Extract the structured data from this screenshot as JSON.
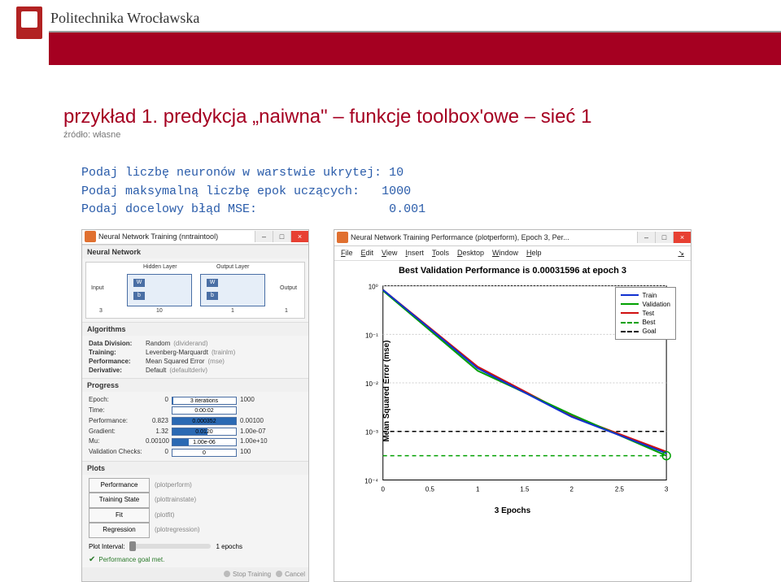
{
  "header": {
    "university": "Politechnika Wrocławska"
  },
  "slide": {
    "title": "przykład 1. predykcja „naiwna\" – funkcje toolbox'owe – sieć 1",
    "source": "źródło: własne"
  },
  "prompts": {
    "line1_label": "Podaj liczbę neuronów w warstwie ukrytej:",
    "line1_val": "10",
    "line2_label": "Podaj maksymalną liczbę epok uczących:",
    "line2_val": "1000",
    "line3_label": "Podaj docelowy błąd MSE:",
    "line3_val": "0.001"
  },
  "tool": {
    "window_title": "Neural Network Training (nntraintool)",
    "section_nn": "Neural Network",
    "diagram": {
      "input": "Input",
      "hidden": "Hidden Layer",
      "output_layer": "Output Layer",
      "output": "Output",
      "in_size": "3",
      "hidden_size": "10",
      "out_size": "1",
      "out_out": "1"
    },
    "section_algo": "Algorithms",
    "algos": [
      {
        "k": "Data Division:",
        "v": "Random",
        "g": "(dividerand)"
      },
      {
        "k": "Training:",
        "v": "Levenberg-Marquardt",
        "g": "(trainlm)"
      },
      {
        "k": "Performance:",
        "v": "Mean Squared Error",
        "g": "(mse)"
      },
      {
        "k": "Derivative:",
        "v": "Default",
        "g": "(defaultderiv)"
      }
    ],
    "section_prog": "Progress",
    "progress": [
      {
        "k": "Epoch:",
        "left": "0",
        "text": "3 iterations",
        "right": "1000",
        "fill": 0.003
      },
      {
        "k": "Time:",
        "left": "",
        "text": "0:00:02",
        "right": "",
        "fill": 0
      },
      {
        "k": "Performance:",
        "left": "0.823",
        "text": "0.000352",
        "right": "0.00100",
        "fill": 1.0
      },
      {
        "k": "Gradient:",
        "left": "1.32",
        "text": "0.0120",
        "right": "1.00e-07",
        "fill": 0.55
      },
      {
        "k": "Mu:",
        "left": "0.00100",
        "text": "1.00e-06",
        "right": "1.00e+10",
        "fill": 0.25
      },
      {
        "k": "Validation Checks:",
        "left": "0",
        "text": "0",
        "right": "100",
        "fill": 0
      }
    ],
    "section_plots": "Plots",
    "plots": [
      {
        "btn": "Performance",
        "lab": "(plotperform)"
      },
      {
        "btn": "Training State",
        "lab": "(plottrainstate)"
      },
      {
        "btn": "Fit",
        "lab": "(plotfit)"
      },
      {
        "btn": "Regression",
        "lab": "(plotregression)"
      }
    ],
    "plot_interval_label": "Plot Interval:",
    "plot_interval_value": "1 epochs",
    "goal_msg": "Performance goal met.",
    "stop_btn": "Stop Training",
    "cancel_btn": "Cancel"
  },
  "perf": {
    "window_title": "Neural Network Training Performance (plotperform), Epoch 3, Per...",
    "menu": [
      "File",
      "Edit",
      "View",
      "Insert",
      "Tools",
      "Desktop",
      "Window",
      "Help"
    ],
    "title": "Best Validation Performance is 0.00031596 at epoch 3",
    "ylabel": "Mean Squared Error (mse)",
    "xlabel": "3 Epochs",
    "legend": [
      {
        "label": "Train",
        "color": "#1030d0",
        "dash": false
      },
      {
        "label": "Validation",
        "color": "#00a000",
        "dash": false
      },
      {
        "label": "Test",
        "color": "#d01010",
        "dash": false
      },
      {
        "label": "Best",
        "color": "#00a000",
        "dash": true
      },
      {
        "label": "Goal",
        "color": "#101010",
        "dash": true
      }
    ],
    "xticks": [
      "0",
      "0.5",
      "1",
      "1.5",
      "2",
      "2.5",
      "3"
    ],
    "yticks": [
      "10⁰",
      "10⁻¹",
      "10⁻²",
      "10⁻³",
      "10⁻⁴"
    ]
  },
  "chart_data": {
    "type": "line",
    "title": "Best Validation Performance is 0.00031596 at epoch 3",
    "xlabel": "3 Epochs",
    "ylabel": "Mean Squared Error (mse)",
    "x": [
      0,
      1,
      2,
      3
    ],
    "yscale": "log",
    "ylim": [
      0.0001,
      1
    ],
    "xlim": [
      0,
      3
    ],
    "series": [
      {
        "name": "Train",
        "color": "#1030d0",
        "values": [
          0.823,
          0.02,
          0.002,
          0.00035
        ]
      },
      {
        "name": "Validation",
        "color": "#00a000",
        "values": [
          0.8,
          0.018,
          0.0022,
          0.00032
        ]
      },
      {
        "name": "Test",
        "color": "#d01010",
        "values": [
          0.79,
          0.022,
          0.0021,
          0.00038
        ]
      },
      {
        "name": "Best",
        "color": "#00a000",
        "style": "dashed",
        "values": [
          0.00032,
          0.00032,
          0.00032,
          0.00032
        ]
      },
      {
        "name": "Goal",
        "color": "#101010",
        "style": "dashed",
        "values": [
          0.001,
          0.001,
          0.001,
          0.001
        ]
      }
    ]
  }
}
